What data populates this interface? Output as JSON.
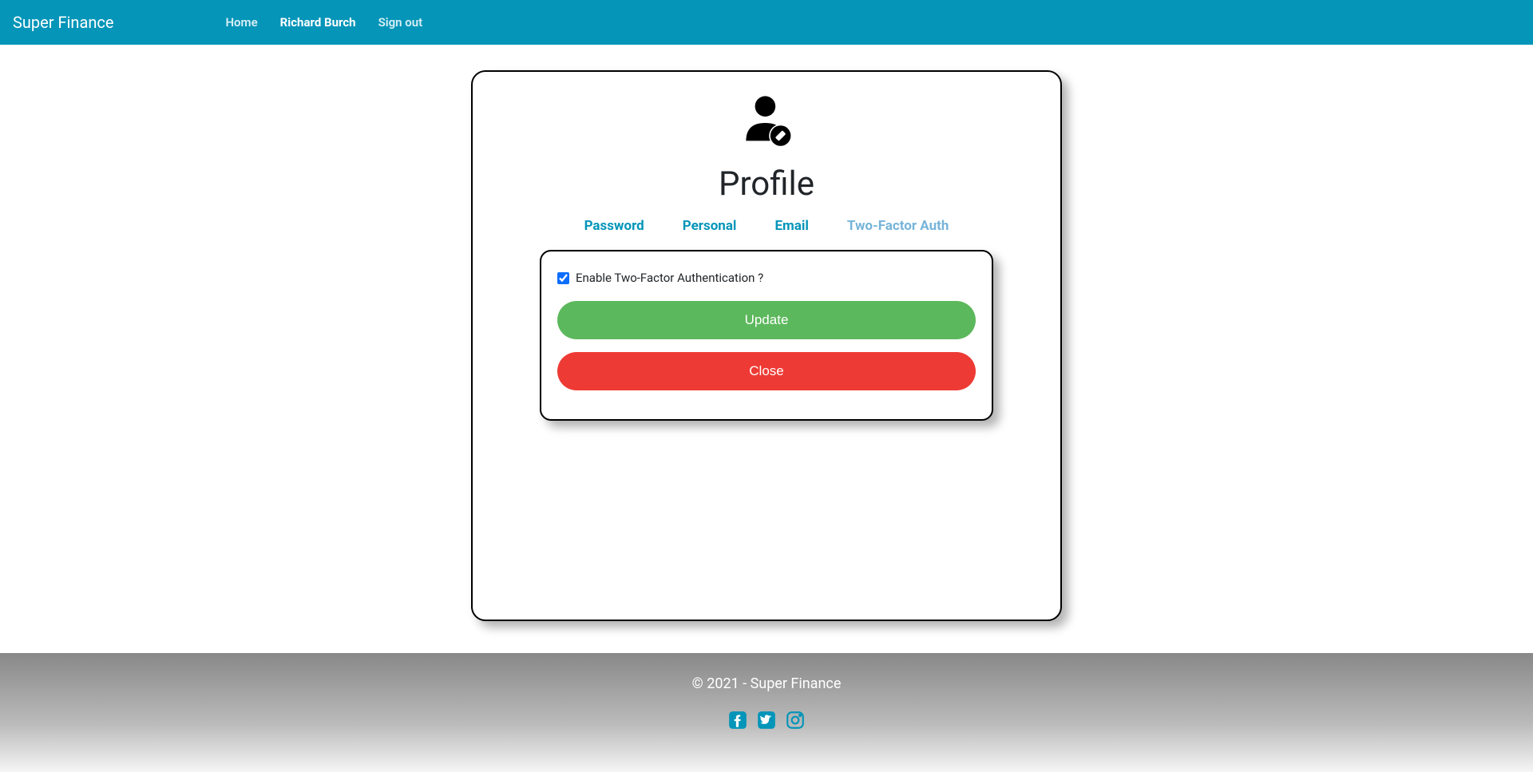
{
  "navbar": {
    "brand": "Super Finance",
    "links": {
      "home": "Home",
      "user": "Richard Burch",
      "signout": "Sign out"
    }
  },
  "profile": {
    "title": "Profile",
    "tabs": {
      "password": "Password",
      "personal": "Personal",
      "email": "Email",
      "twofactor": "Two-Factor Auth"
    },
    "checkbox_label": "Enable Two-Factor Authentication ?",
    "checkbox_checked": true,
    "update_button": "Update",
    "close_button": "Close"
  },
  "footer": {
    "copyright": "© 2021 - Super Finance"
  }
}
